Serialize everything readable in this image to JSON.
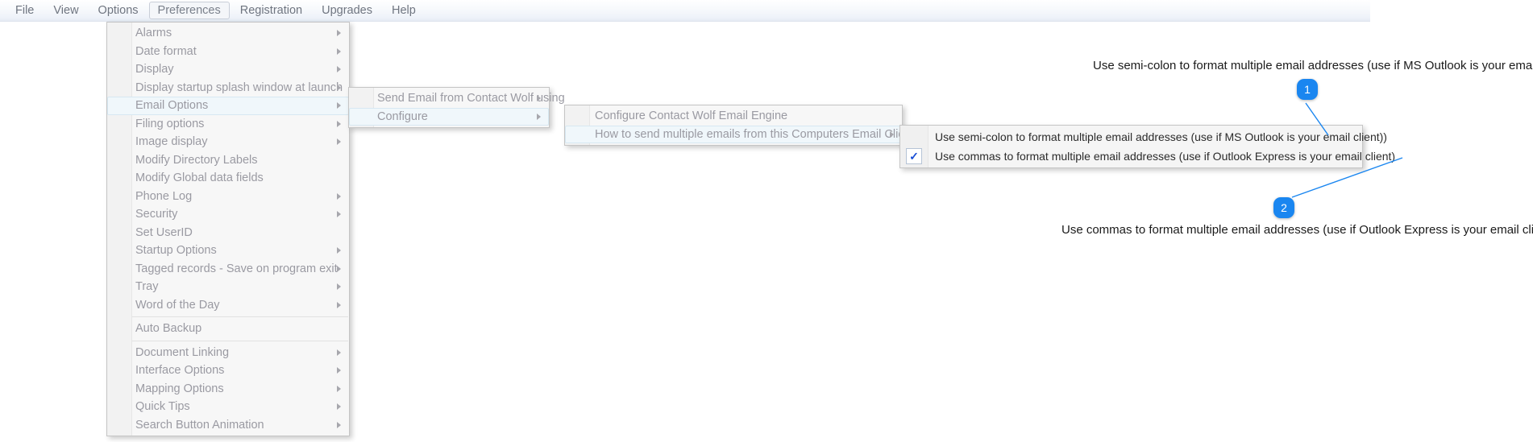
{
  "menubar": {
    "items": [
      {
        "label": "File",
        "open": false
      },
      {
        "label": "View",
        "open": false
      },
      {
        "label": "Options",
        "open": false
      },
      {
        "label": "Preferences",
        "open": true
      },
      {
        "label": "Registration",
        "open": false
      },
      {
        "label": "Upgrades",
        "open": false
      },
      {
        "label": "Help",
        "open": false
      }
    ]
  },
  "menu_preferences": {
    "name": "Preferences",
    "items": [
      {
        "label": "Alarms",
        "submenu": true
      },
      {
        "label": "Date format",
        "submenu": true
      },
      {
        "label": "Display",
        "submenu": true
      },
      {
        "label": "Display startup splash window at launch",
        "submenu": true
      },
      {
        "label": "Email Options",
        "submenu": true,
        "highlight": true
      },
      {
        "label": "Filing options",
        "submenu": true
      },
      {
        "label": "Image display",
        "submenu": true
      },
      {
        "label": "Modify Directory Labels",
        "submenu": false
      },
      {
        "label": "Modify Global data fields",
        "submenu": false
      },
      {
        "label": "Phone Log",
        "submenu": true
      },
      {
        "label": "Security",
        "submenu": true
      },
      {
        "label": "Set UserID",
        "submenu": false
      },
      {
        "label": "Startup Options",
        "submenu": true
      },
      {
        "label": "Tagged records - Save on program exit",
        "submenu": true
      },
      {
        "label": "Tray",
        "submenu": true
      },
      {
        "label": "Word of the Day",
        "submenu": true
      },
      {
        "separator": true
      },
      {
        "label": "Auto Backup",
        "submenu": false
      },
      {
        "separator": true
      },
      {
        "label": "Document Linking",
        "submenu": true
      },
      {
        "label": "Interface Options",
        "submenu": true
      },
      {
        "label": "Mapping Options",
        "submenu": true
      },
      {
        "label": "Quick Tips",
        "submenu": true
      },
      {
        "label": "Search Button Animation",
        "submenu": true
      }
    ]
  },
  "menu_email_options": {
    "name": "Email Options",
    "items": [
      {
        "label": "Send Email from Contact Wolf using",
        "submenu": true
      },
      {
        "label": "Configure",
        "submenu": true,
        "highlight": true
      }
    ]
  },
  "menu_configure": {
    "name": "Configure",
    "items": [
      {
        "label": "Configure Contact Wolf Email Engine",
        "submenu": false
      },
      {
        "label": "How to send multiple emails from this Computers Email Client",
        "submenu": true,
        "highlight": true
      }
    ]
  },
  "menu_email_format": {
    "name": "How to send multiple emails from this Computers Email Client",
    "items": [
      {
        "label": "Use semi-colon to format multiple email addresses (use if MS Outlook is your email client))",
        "checked": false,
        "check_glyph": ""
      },
      {
        "label": "Use commas to format multiple email addresses (use if Outlook Express is your email client)",
        "checked": true,
        "check_glyph": "✓"
      }
    ]
  },
  "annotations": {
    "accent_color": "#1a86f0",
    "items": [
      {
        "number": "1",
        "text": "Use semi-colon to format multiple email addresses (use if MS Outlook is your email client))"
      },
      {
        "number": "2",
        "text": "Use commas to format multiple email addresses (use if Outlook Express is your email client)"
      }
    ]
  }
}
